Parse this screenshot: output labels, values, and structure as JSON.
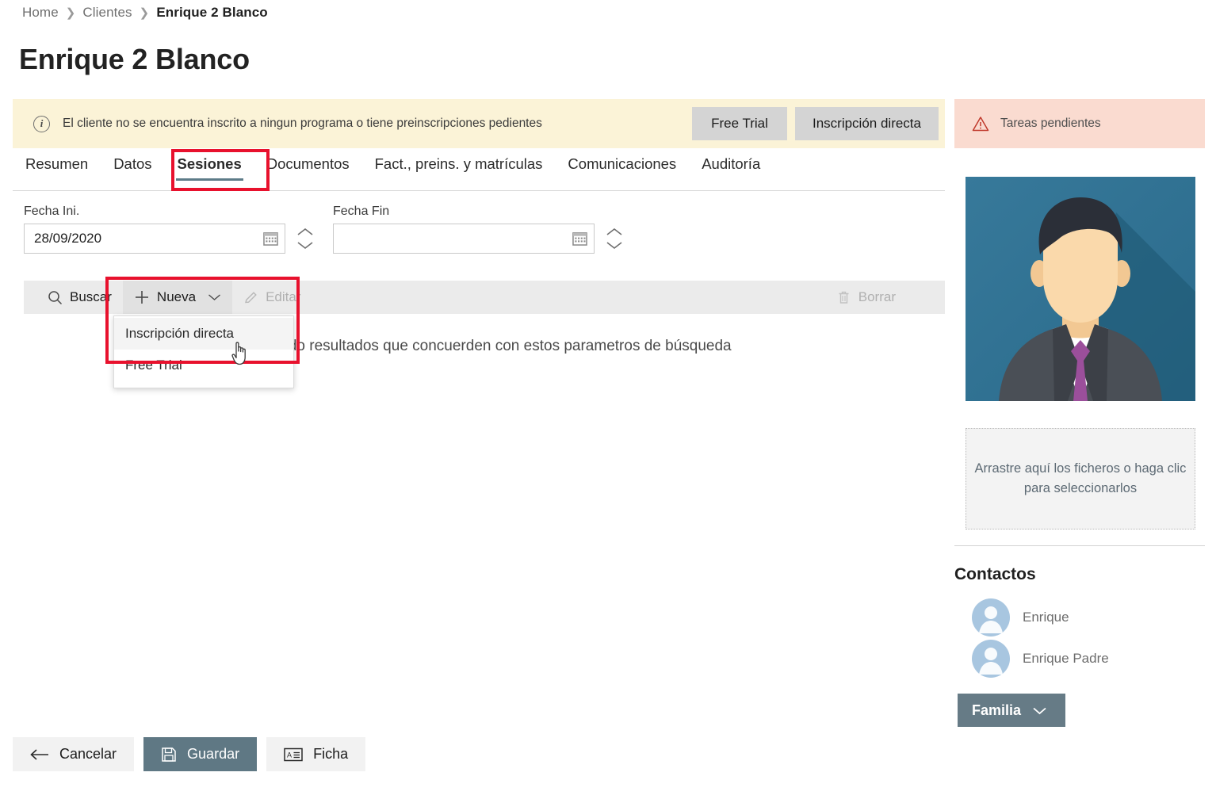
{
  "breadcrumb": [
    {
      "label": "Home",
      "current": false
    },
    {
      "label": "Clientes",
      "current": false
    },
    {
      "label": "Enrique 2 Blanco",
      "current": true
    }
  ],
  "page_title": "Enrique 2 Blanco",
  "info_bar": {
    "icon": "info-circle-icon",
    "message": "El cliente no se encuentra inscrito a ningun programa o tiene preinscripciones pedientes",
    "buttons": [
      {
        "label": "Free Trial"
      },
      {
        "label": "Inscripción directa"
      }
    ],
    "background_color": "#fbf3d7"
  },
  "tabs": [
    {
      "label": "Resumen",
      "active": false
    },
    {
      "label": "Datos",
      "active": false
    },
    {
      "label": "Sesiones",
      "active": true
    },
    {
      "label": "Documentos",
      "active": false
    },
    {
      "label": "Fact., preins. y matrículas",
      "active": false
    },
    {
      "label": "Comunicaciones",
      "active": false
    },
    {
      "label": "Auditoría",
      "active": false
    }
  ],
  "filters": {
    "fecha_ini": {
      "label": "Fecha Ini.",
      "value": "28/09/2020",
      "placeholder": ""
    },
    "fecha_fin": {
      "label": "Fecha Fin",
      "value": "",
      "placeholder": ""
    }
  },
  "toolbar": {
    "search_label": "Buscar",
    "new_label": "Nueva",
    "edit_label": "Editar",
    "delete_label": "Borrar",
    "edit_disabled": true,
    "delete_disabled": true
  },
  "dropdown": {
    "open": true,
    "items": [
      {
        "label": "Inscripción directa",
        "hovered": true
      },
      {
        "label": "Free Trial",
        "hovered": false
      }
    ]
  },
  "results": {
    "empty_message": "No se han encontrado resultados que concuerden con estos parametros de búsqueda"
  },
  "annotations": {
    "color": "#e8112d",
    "boxes": [
      {
        "target": "sesiones-tab"
      },
      {
        "target": "nueva-dropdown"
      }
    ]
  },
  "right_panel": {
    "alert": {
      "icon": "warning-triangle-icon",
      "label": "Tareas pendientes",
      "background_color": "#fadbd0",
      "icon_color": "#c0392b"
    },
    "avatar": {
      "name": "client-avatar-illustration",
      "background_color": "#2f7190",
      "hair_color": "#2b2f38",
      "skin_color": "#fad9ab",
      "suit_color": "#4a4f56",
      "shirt_color": "#ffffff",
      "tie_color": "#9b4f9b"
    },
    "dropzone": {
      "text": "Arrastre aquí los ficheros o haga clic para seleccionarlos"
    },
    "contacts": {
      "title": "Contactos",
      "items": [
        {
          "name": "Enrique"
        },
        {
          "name": "Enrique Padre"
        }
      ],
      "familia_button": {
        "label": "Familia",
        "color": "#667b86"
      }
    }
  },
  "actions": [
    {
      "label": "Cancelar",
      "icon": "arrow-left-icon",
      "style": "light"
    },
    {
      "label": "Guardar",
      "icon": "save-icon",
      "style": "primary"
    },
    {
      "label": "Ficha",
      "icon": "id-card-icon",
      "style": "light"
    }
  ]
}
